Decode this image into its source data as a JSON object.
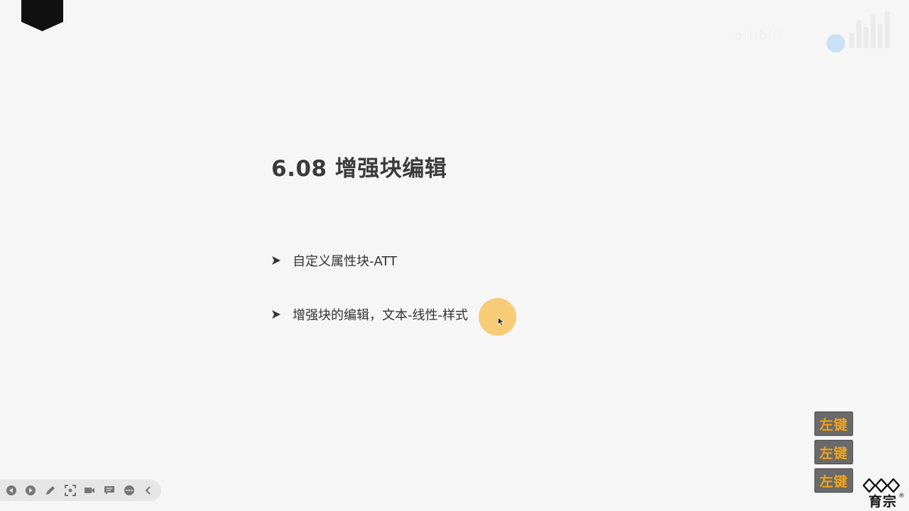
{
  "slide": {
    "title": "6.08 增强块编辑",
    "bullets": [
      {
        "text": "自定义属性块-ATT"
      },
      {
        "text": "增强块的编辑，文本-线性-样式"
      }
    ]
  },
  "watermark": {
    "text": "bilibili"
  },
  "key_indicators": [
    "左键",
    "左键",
    "左键"
  ],
  "brand": {
    "name": "育宗",
    "mark": "®"
  },
  "toolbar": {
    "buttons": [
      {
        "icon": "prev-slide-icon"
      },
      {
        "icon": "next-slide-icon"
      },
      {
        "icon": "pen-icon"
      },
      {
        "icon": "focus-icon"
      },
      {
        "icon": "camera-icon"
      },
      {
        "icon": "comment-icon"
      },
      {
        "icon": "more-icon"
      },
      {
        "icon": "collapse-icon"
      }
    ]
  },
  "colors": {
    "background": "#f6f6f6",
    "title": "#3b3b3b",
    "cursor_halo": "#f5c86a",
    "key_text": "#f0a21c",
    "key_bg": "#6a6a6a",
    "toolbar_bg": "#e6e6e6"
  }
}
